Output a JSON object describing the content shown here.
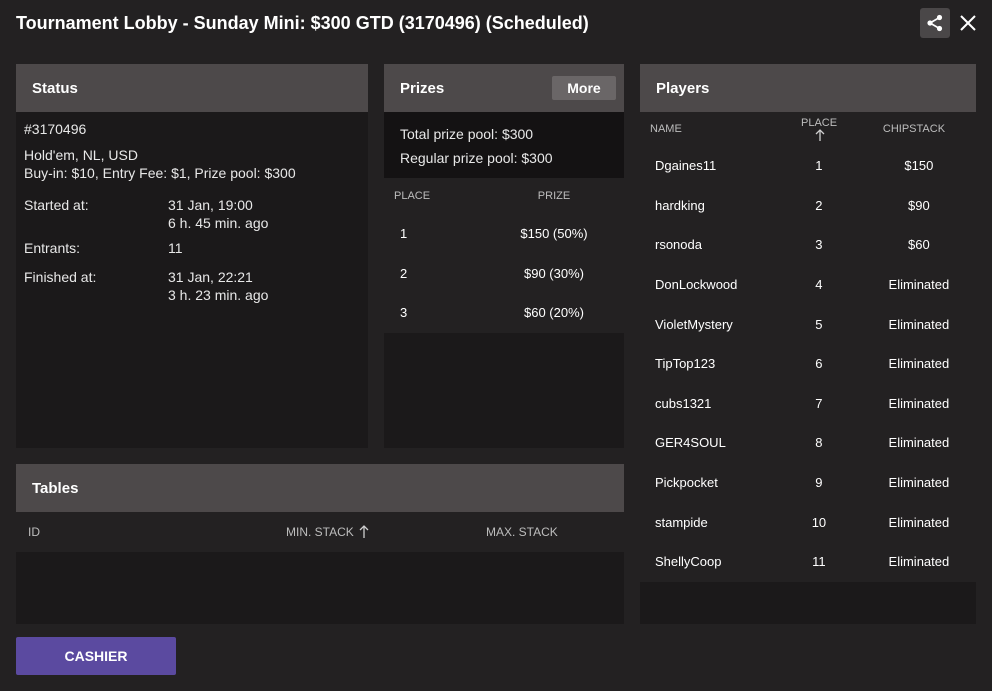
{
  "window": {
    "title": "Tournament Lobby - Sunday Mini: $300 GTD (3170496) (Scheduled)",
    "share_icon": "share-icon",
    "close_icon": "close-icon"
  },
  "status": {
    "header": "Status",
    "id": "#3170496",
    "game": "Hold'em, NL, USD",
    "buyin": "Buy-in: $10, Entry Fee: $1, Prize pool: $300",
    "started_label": "Started at:",
    "started_value": "31 Jan, 19:00",
    "started_ago": "6 h. 45 min. ago",
    "entrants_label": "Entrants:",
    "entrants_value": "11",
    "finished_label": "Finished at:",
    "finished_value": "31 Jan, 22:21",
    "finished_ago": "3 h. 23 min. ago"
  },
  "prizes": {
    "header": "Prizes",
    "more_label": "More",
    "total_pool": "Total prize pool: $300",
    "regular_pool": "Regular prize pool: $300",
    "col_place": "PLACE",
    "col_prize": "PRIZE",
    "rows": [
      {
        "place": "1",
        "prize": "$150 (50%)"
      },
      {
        "place": "2",
        "prize": "$90 (30%)"
      },
      {
        "place": "3",
        "prize": "$60 (20%)"
      }
    ]
  },
  "players": {
    "header": "Players",
    "col_name": "NAME",
    "col_place": "PLACE",
    "col_chips": "CHIPSTACK",
    "rows": [
      {
        "name": "Dgaines11",
        "place": "1",
        "chips": "$150"
      },
      {
        "name": "hardking",
        "place": "2",
        "chips": "$90"
      },
      {
        "name": "rsonoda",
        "place": "3",
        "chips": "$60"
      },
      {
        "name": "DonLockwood",
        "place": "4",
        "chips": "Eliminated"
      },
      {
        "name": "VioletMystery",
        "place": "5",
        "chips": "Eliminated"
      },
      {
        "name": "TipTop123",
        "place": "6",
        "chips": "Eliminated"
      },
      {
        "name": "cubs1321",
        "place": "7",
        "chips": "Eliminated"
      },
      {
        "name": "GER4SOUL",
        "place": "8",
        "chips": "Eliminated"
      },
      {
        "name": "Pickpocket",
        "place": "9",
        "chips": "Eliminated"
      },
      {
        "name": "stampide",
        "place": "10",
        "chips": "Eliminated"
      },
      {
        "name": "ShellyCoop",
        "place": "11",
        "chips": "Eliminated"
      }
    ]
  },
  "tables": {
    "header": "Tables",
    "col_id": "ID",
    "col_min": "MIN. STACK",
    "col_max": "MAX. STACK"
  },
  "footer": {
    "cashier_label": "CASHIER"
  },
  "colors": {
    "background": "#232122",
    "panel_header": "#4d494a",
    "cashier": "#5b4aa0"
  }
}
